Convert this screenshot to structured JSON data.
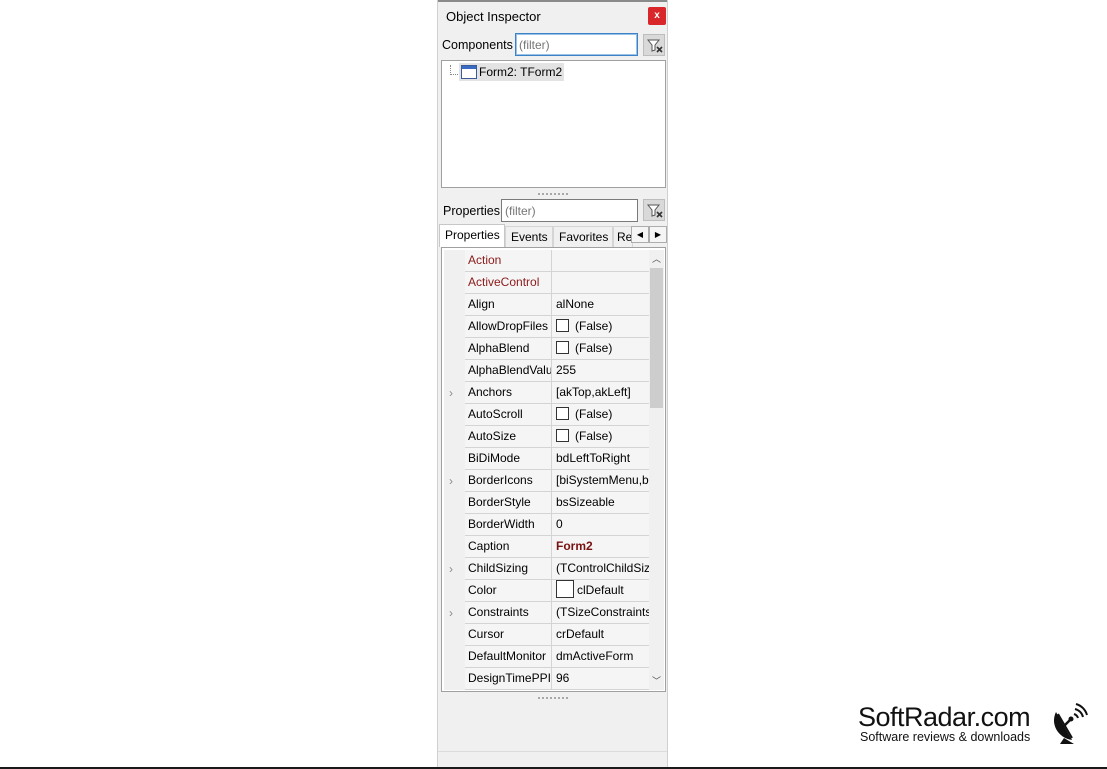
{
  "window": {
    "title": "Object Inspector",
    "close_label": "x"
  },
  "components": {
    "label": "Components",
    "filter_placeholder": "(filter)",
    "tree": [
      {
        "label": "Form2: TForm2"
      }
    ]
  },
  "properties": {
    "label": "Properties",
    "filter_placeholder": "(filter)",
    "tabs": [
      "Properties",
      "Events",
      "Favorites",
      "Re"
    ],
    "active_tab": "Properties",
    "rows": [
      {
        "name": "Action",
        "value": "",
        "expandable": false,
        "red": true
      },
      {
        "name": "ActiveControl",
        "value": "",
        "expandable": false,
        "red": true
      },
      {
        "name": "Align",
        "value": "alNone",
        "expandable": false
      },
      {
        "name": "AllowDropFiles",
        "value": "(False)",
        "expandable": false,
        "checkbox": true
      },
      {
        "name": "AlphaBlend",
        "value": "(False)",
        "expandable": false,
        "checkbox": true
      },
      {
        "name": "AlphaBlendValue",
        "value": "255",
        "expandable": false
      },
      {
        "name": "Anchors",
        "value": "[akTop,akLeft]",
        "expandable": true
      },
      {
        "name": "AutoScroll",
        "value": "(False)",
        "expandable": false,
        "checkbox": true
      },
      {
        "name": "AutoSize",
        "value": "(False)",
        "expandable": false,
        "checkbox": true
      },
      {
        "name": "BiDiMode",
        "value": "bdLeftToRight",
        "expandable": false
      },
      {
        "name": "BorderIcons",
        "value": "[biSystemMenu,biMinimize,biMaximize]",
        "expandable": true
      },
      {
        "name": "BorderStyle",
        "value": "bsSizeable",
        "expandable": false
      },
      {
        "name": "BorderWidth",
        "value": "0",
        "expandable": false
      },
      {
        "name": "Caption",
        "value": "Form2",
        "expandable": false,
        "bold": true
      },
      {
        "name": "ChildSizing",
        "value": "(TControlChildSizing)",
        "expandable": true
      },
      {
        "name": "Color",
        "value": "clDefault",
        "expandable": false,
        "swatch": true
      },
      {
        "name": "Constraints",
        "value": "(TSizeConstraints)",
        "expandable": true
      },
      {
        "name": "Cursor",
        "value": "crDefault",
        "expandable": false
      },
      {
        "name": "DefaultMonitor",
        "value": "dmActiveForm",
        "expandable": false
      },
      {
        "name": "DesignTimePPI",
        "value": "96",
        "expandable": false
      }
    ]
  },
  "watermark": {
    "title": "SoftRadar.com",
    "subtitle": "Software reviews & downloads"
  },
  "icons": {
    "close": "close-icon",
    "filter_clear": "filter-clear-icon",
    "form": "form-icon",
    "expand": "chevron-right-icon",
    "scroll_up": "chevron-up-icon",
    "scroll_down": "chevron-down-icon",
    "tab_left": "arrow-left-icon",
    "tab_right": "arrow-right-icon",
    "satellite": "satellite-dish-icon"
  },
  "colors": {
    "close_button": "#d9262b",
    "highlight_text": "#8b1a1a",
    "focus_border": "#3c82c7"
  }
}
